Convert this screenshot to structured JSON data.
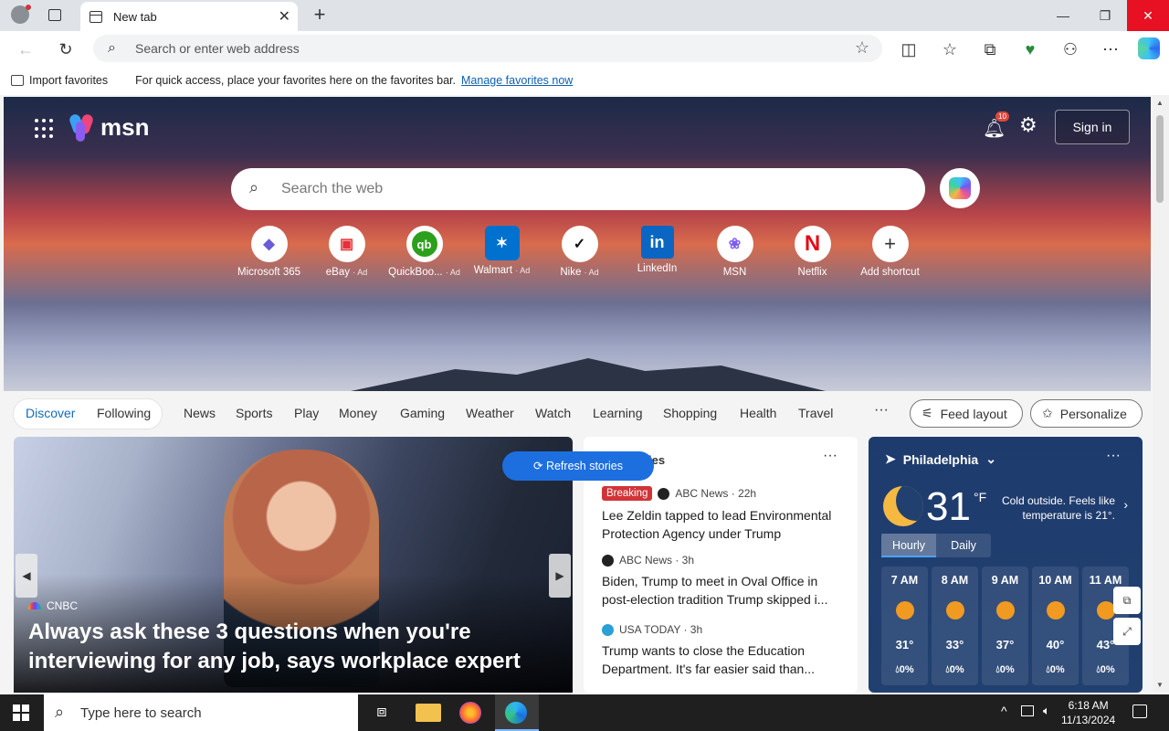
{
  "browser": {
    "tab_title": "New tab",
    "address_placeholder": "Search or enter web address",
    "favorites_bar": {
      "import_label": "Import favorites",
      "message": "For quick access, place your favorites here on the favorites bar.",
      "manage_link": "Manage favorites now"
    }
  },
  "msn": {
    "brand": "msn",
    "notification_count": "10",
    "sign_in": "Sign in",
    "search_placeholder": "Search the web",
    "shortcuts": [
      {
        "label": "Microsoft 365",
        "ad": "",
        "icon": "m365-icon",
        "glyph": "◆",
        "color": "#6b5bd6"
      },
      {
        "label": "eBay",
        "ad": "· Ad",
        "icon": "ebay-icon",
        "glyph": "▣",
        "color": "#e53238"
      },
      {
        "label": "QuickBoo...",
        "ad": "· Ad",
        "icon": "quickbooks-icon",
        "glyph": "qb",
        "color": "#2ca01c"
      },
      {
        "label": "Walmart",
        "ad": "· Ad",
        "icon": "walmart-icon",
        "glyph": "✶",
        "color": "#0071ce"
      },
      {
        "label": "Nike",
        "ad": "· Ad",
        "icon": "nike-icon",
        "glyph": "✓",
        "color": "#111111"
      },
      {
        "label": "LinkedIn",
        "ad": "",
        "icon": "linkedin-icon",
        "glyph": "in",
        "color": "#0a66c2"
      },
      {
        "label": "MSN",
        "ad": "",
        "icon": "msn-icon",
        "glyph": "❀",
        "color": "#7d5cf0"
      },
      {
        "label": "Netflix",
        "ad": "",
        "icon": "netflix-icon",
        "glyph": "N",
        "color": "#e50914"
      },
      {
        "label": "Add shortcut",
        "ad": "",
        "icon": "plus-icon",
        "glyph": "+",
        "color": "#333333"
      }
    ],
    "nav": {
      "discover": "Discover",
      "following": "Following",
      "items": [
        "News",
        "Sports",
        "Play",
        "Money",
        "Gaming",
        "Weather",
        "Watch",
        "Learning",
        "Shopping",
        "Health",
        "Travel"
      ],
      "more": "···",
      "feed_layout": "Feed layout",
      "personalize": "Personalize"
    },
    "lead_story": {
      "source": "CNBC",
      "headline": "Always ask these 3 questions when you're interviewing for any job, says workplace expert"
    },
    "refresh": "Refresh stories",
    "top_stories": {
      "title": "Top stories",
      "stories": [
        {
          "badge": "Breaking",
          "source": "ABC News · 22h",
          "title": "Lee Zeldin tapped to lead Environmental Protection Agency under Trump",
          "logo_color": "#222222"
        },
        {
          "badge": "",
          "source": "ABC News · 3h",
          "title": "Biden, Trump to meet in Oval Office in post-election tradition Trump skipped i...",
          "logo_color": "#222222"
        },
        {
          "badge": "",
          "source": "USA TODAY · 3h",
          "title": "Trump wants to close the Education Department. It's far easier said than...",
          "logo_color": "#2a9fd8"
        }
      ]
    },
    "weather": {
      "location": "Philadelphia",
      "temp": "31",
      "unit": "°F",
      "note": "Cold outside. Feels like temperature is 21°.",
      "tabs": [
        "Hourly",
        "Daily"
      ],
      "hours": [
        {
          "time": "7 AM",
          "temp": "31°",
          "precip": "0%"
        },
        {
          "time": "8 AM",
          "temp": "33°",
          "precip": "0%"
        },
        {
          "time": "9 AM",
          "temp": "37°",
          "precip": "0%"
        },
        {
          "time": "10 AM",
          "temp": "40°",
          "precip": "0%"
        },
        {
          "time": "11 AM",
          "temp": "43°",
          "precip": "0%"
        }
      ]
    }
  },
  "taskbar": {
    "search_placeholder": "Type here to search",
    "time": "6:18 AM",
    "date": "11/13/2024"
  }
}
